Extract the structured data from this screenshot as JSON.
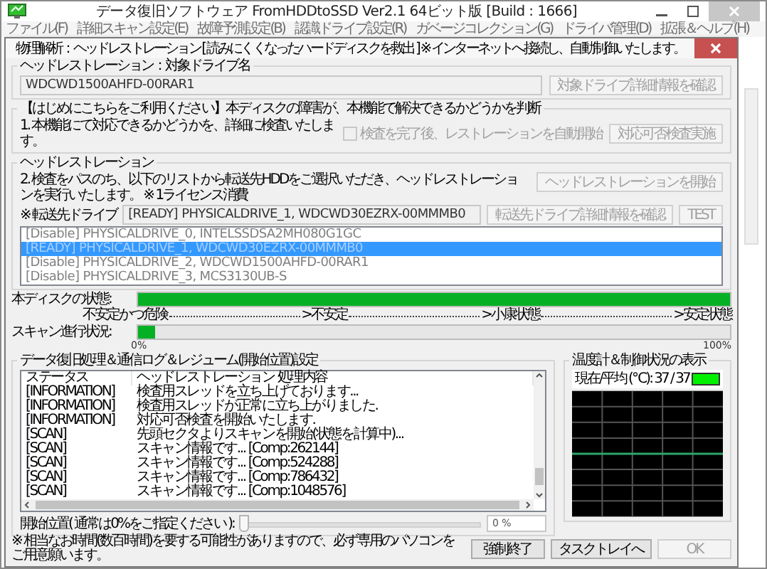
{
  "window": {
    "title": "データ復旧ソフトウェア FromHDDtoSSD Ver2.1 64ビット版 [Build : 1666]"
  },
  "menu": [
    {
      "label": "ファイル(F)"
    },
    {
      "label": "詳細スキャン設定(E)"
    },
    {
      "label": "故障予測設定(B)"
    },
    {
      "label": "認識ドライブ設定(R)"
    },
    {
      "label": "ガベージコレクション(G)"
    },
    {
      "label": "ドライバ管理(D)"
    },
    {
      "label": "拡張＆ヘルプ(H)"
    }
  ],
  "dialog": {
    "title": "物理解析：ヘッドレストレーション [ 読みにくくなったハードディスクを救出 ] ※ インターネットへ接続し、自動制御いたします。"
  },
  "target": {
    "legend": "ヘッドレストレーション：対象ドライブ名",
    "drive_name": "WDCWD1500AHFD-00RAR1",
    "button": {
      "label": "対象ドライブ詳細情報を確認",
      "disabled": true
    }
  },
  "precheck": {
    "legend": "【はじめにこちらをご利用ください】本ディスクの障害が、本機能で解決できるかどうかを判断",
    "text": "1. 本機能にて対応できるかどうかを、詳細に検査いたします。",
    "checkbox": {
      "label": "検査を完了後、レストレーションを自動開始",
      "checked": false,
      "disabled": true
    },
    "button": {
      "label": "対応可否検査実施",
      "disabled": true
    }
  },
  "restoration": {
    "legend": "ヘッドレストレーション",
    "text": "2. 検査をパスのち、以下のリストから転送先HDDをご選択いただき、ヘッドレストレーションを実行いたします。 ※ 1ライセンス消費",
    "start_button": {
      "label": "ヘッドレストレーションを開始",
      "disabled": true
    },
    "dest_label": "※ 転送先ドライブ",
    "dest_value": "[READY] PHYSICALDRIVE_1, WDCWD30EZRX-00MMMB0",
    "detail_button": {
      "label": "転送先ドライブ詳細情報を確認",
      "disabled": true
    },
    "test_button": {
      "label": "TEST",
      "disabled": true
    },
    "drives": [
      {
        "label": "[Disable] PHYSICALDRIVE_0, INTELSSDSA2MH080G1GC",
        "selected": false
      },
      {
        "label": "[READY] PHYSICALDRIVE_1, WDCWD30EZRX-00MMMB0",
        "selected": true
      },
      {
        "label": "[Disable] PHYSICALDRIVE_2, WDCWD1500AHFD-00RAR1",
        "selected": false
      },
      {
        "label": "[Disable] PHYSICALDRIVE_3, MCS3130UB-S",
        "selected": false
      }
    ]
  },
  "disk_state": {
    "label": "本ディスクの状態:",
    "level": 1,
    "scale": [
      "不安定かつ危険",
      ">不安定",
      ">小康状態",
      ">安定状態"
    ]
  },
  "scan": {
    "label": "スキャン進行状況:",
    "level": 0.03,
    "min": "0%",
    "max": "100%"
  },
  "log": {
    "legend": "データ復旧処理＆通信ログ＆レジューム(開始位置)設定",
    "columns": [
      "ステータス",
      "ヘッドレストレーション 処理内容"
    ],
    "rows": [
      [
        "[INFORMATION]",
        "検査用スレッドを立ち上げております..."
      ],
      [
        "[INFORMATION]",
        "検査用スレッドが正常に立ち上がりました."
      ],
      [
        "[INFORMATION]",
        "対応可否検査を開始いたします."
      ],
      [
        "[SCAN]",
        "先頭セクタよりスキャンを開始(状態を計算中)..."
      ],
      [
        "[SCAN]",
        "スキャン情報です... [Comp:262144]"
      ],
      [
        "[SCAN]",
        "スキャン情報です... [Comp:524288]"
      ],
      [
        "[SCAN]",
        "スキャン情報です... [Comp:786432]"
      ],
      [
        "[SCAN]",
        "スキャン情報です... [Comp:1048576]"
      ]
    ],
    "start_label": "開始位置( 通常は0%をご指定ください ):",
    "start_slider": {
      "level": 0
    },
    "start_value": "0 %"
  },
  "temperature": {
    "legend": "温度計＆制御状況の表示",
    "reading": "現在/平均 (℃): 37 / 37"
  },
  "footer": {
    "note": "※ 相当なお時間(数百時間)を要する可能性がありますので、必ず専用のパソコンをご用意願います。",
    "buttons": [
      {
        "label": "強制終了",
        "disabled": false
      },
      {
        "label": "タスクトレイへ",
        "disabled": false
      },
      {
        "label": "OK",
        "disabled": true
      }
    ]
  }
}
